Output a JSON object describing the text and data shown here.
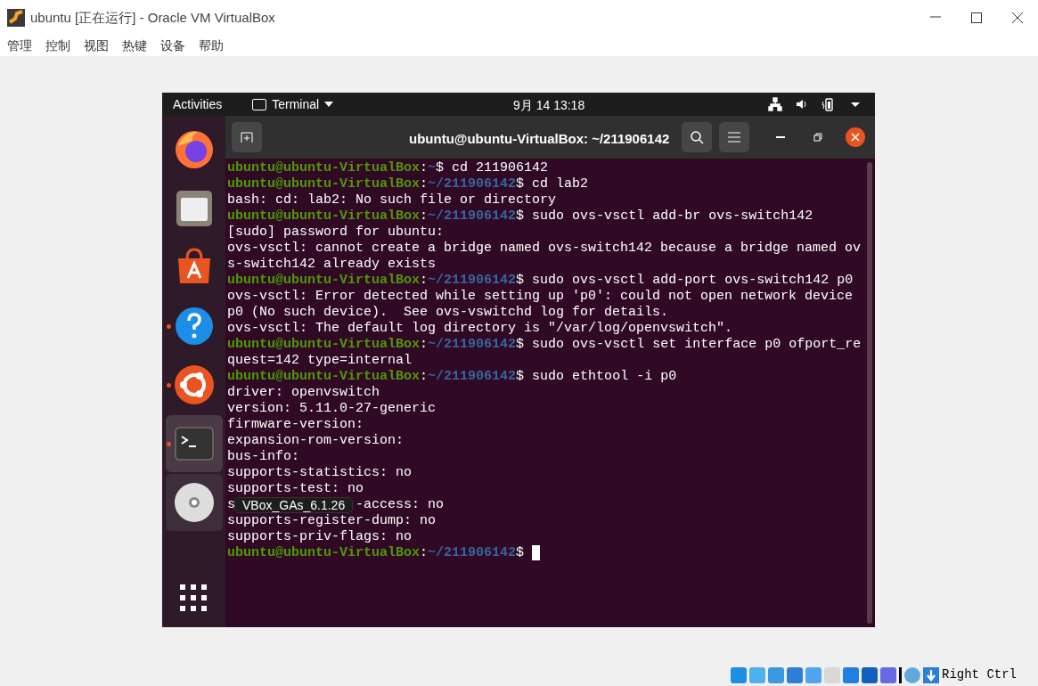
{
  "window": {
    "title": "ubuntu [正在运行] - Oracle VM VirtualBox"
  },
  "menu": [
    "管理",
    "控制",
    "视图",
    "热键",
    "设备",
    "帮助"
  ],
  "topbar": {
    "activities": "Activities",
    "app": "Terminal",
    "clock": "9月 14  13:18"
  },
  "dock": [
    {
      "kind": "firefox",
      "running": false,
      "selected": false
    },
    {
      "kind": "files",
      "running": false,
      "selected": false
    },
    {
      "kind": "software",
      "running": false,
      "selected": false
    },
    {
      "kind": "help",
      "running": true,
      "selected": false
    },
    {
      "kind": "ubuntu",
      "running": true,
      "selected": false
    },
    {
      "kind": "terminal",
      "running": true,
      "selected": true
    },
    {
      "kind": "disc",
      "running": false,
      "selected": false,
      "tooltip": "VBox_GAs_6.1.26"
    }
  ],
  "terminal": {
    "title": "ubuntu@ubuntu-VirtualBox: ~/211906142",
    "lines": [
      {
        "kind": "prompt",
        "user": "ubuntu@ubuntu-VirtualBox",
        "colon": ":",
        "path": "~",
        "dollar": "$",
        "command": "cd 211906142"
      },
      {
        "kind": "prompt",
        "user": "ubuntu@ubuntu-VirtualBox",
        "colon": ":",
        "path": "~/211906142",
        "dollar": "$",
        "command": "cd lab2"
      },
      {
        "kind": "output",
        "text": "bash: cd: lab2: No such file or directory"
      },
      {
        "kind": "prompt",
        "user": "ubuntu@ubuntu-VirtualBox",
        "colon": ":",
        "path": "~/211906142",
        "dollar": "$",
        "command": "sudo ovs-vsctl add-br ovs-switch142"
      },
      {
        "kind": "output",
        "text": "[sudo] password for ubuntu:"
      },
      {
        "kind": "output",
        "text": "ovs-vsctl: cannot create a bridge named ovs-switch142 because a bridge named ov"
      },
      {
        "kind": "output",
        "text": "s-switch142 already exists"
      },
      {
        "kind": "prompt",
        "user": "ubuntu@ubuntu-VirtualBox",
        "colon": ":",
        "path": "~/211906142",
        "dollar": "$",
        "command": "sudo ovs-vsctl add-port ovs-switch142 p0"
      },
      {
        "kind": "output",
        "text": "ovs-vsctl: Error detected while setting up 'p0': could not open network device"
      },
      {
        "kind": "output",
        "text": "p0 (No such device).  See ovs-vswitchd log for details."
      },
      {
        "kind": "output",
        "text": "ovs-vsctl: The default log directory is \"/var/log/openvswitch\"."
      },
      {
        "kind": "prompt",
        "user": "ubuntu@ubuntu-VirtualBox",
        "colon": ":",
        "path": "~/211906142",
        "dollar": "$",
        "command": "sudo ovs-vsctl set interface p0 ofport_re"
      },
      {
        "kind": "output",
        "text": "quest=142 type=internal"
      },
      {
        "kind": "prompt",
        "user": "ubuntu@ubuntu-VirtualBox",
        "colon": ":",
        "path": "~/211906142",
        "dollar": "$",
        "command": "sudo ethtool -i p0"
      },
      {
        "kind": "output",
        "text": "driver: openvswitch"
      },
      {
        "kind": "output",
        "text": "version: 5.11.0-27-generic"
      },
      {
        "kind": "output",
        "text": "firmware-version:"
      },
      {
        "kind": "output",
        "text": "expansion-rom-version:"
      },
      {
        "kind": "output",
        "text": "bus-info:"
      },
      {
        "kind": "output",
        "text": "supports-statistics: no"
      },
      {
        "kind": "output",
        "text": "supports-test: no"
      },
      {
        "kind": "covered",
        "before": "s",
        "after": "-access: no"
      },
      {
        "kind": "output",
        "text": "supports-register-dump: no"
      },
      {
        "kind": "output",
        "text": "supports-priv-flags: no"
      },
      {
        "kind": "prompt",
        "user": "ubuntu@ubuntu-VirtualBox",
        "colon": ":",
        "path": "~/211906142",
        "dollar": "$",
        "cursor": true
      }
    ]
  },
  "status_bar": {
    "host_key": "Right Ctrl"
  }
}
